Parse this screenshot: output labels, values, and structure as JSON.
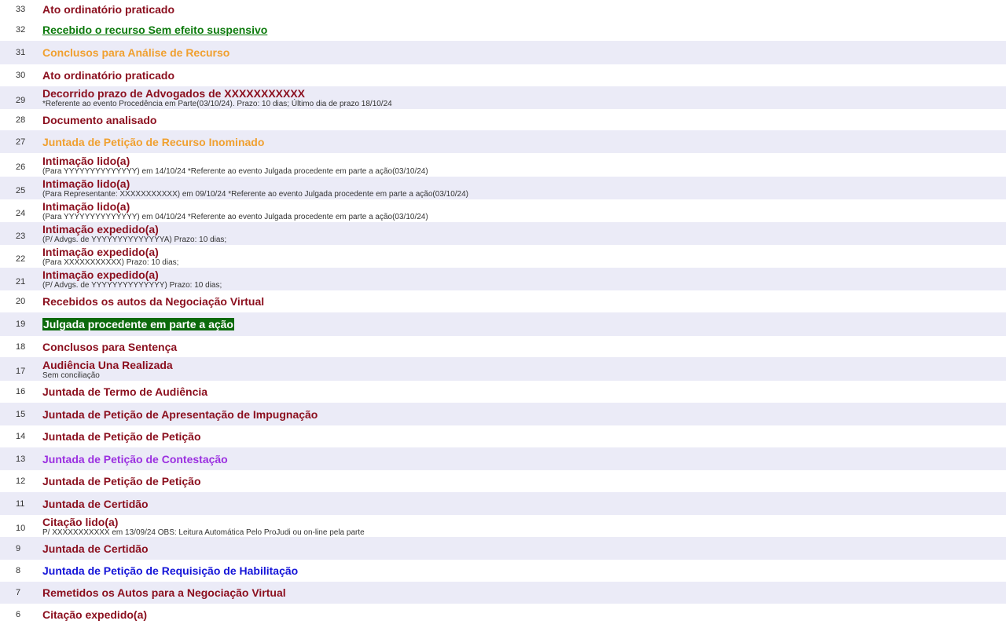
{
  "events": [
    {
      "num": "33",
      "title": "Ato ordinatório praticado",
      "detail": "",
      "style": "maroon"
    },
    {
      "num": "32",
      "title": "Recebido o recurso Sem efeito suspensivo",
      "detail": "",
      "style": "green-link"
    },
    {
      "num": "31",
      "title": "Conclusos para Análise de Recurso",
      "detail": "",
      "style": "orange"
    },
    {
      "num": "30",
      "title": "Ato ordinatório praticado",
      "detail": "",
      "style": "maroon"
    },
    {
      "num": "29",
      "title": "Decorrido prazo de Advogados de XXXXXXXXXXX",
      "detail": "*Referente ao evento Procedência em Parte(03/10/24). Prazo: 10 dias; Último dia de prazo 18/10/24",
      "style": "maroon"
    },
    {
      "num": "28",
      "title": "Documento analisado",
      "detail": "",
      "style": "maroon"
    },
    {
      "num": "27",
      "title": "Juntada de Petição de Recurso Inominado",
      "detail": "",
      "style": "orange"
    },
    {
      "num": "26",
      "title": "Intimação lido(a)",
      "detail": "(Para YYYYYYYYYYYYYY) em 14/10/24 *Referente ao evento Julgada procedente em parte a ação(03/10/24)",
      "style": "maroon"
    },
    {
      "num": "25",
      "title": "Intimação lido(a)",
      "detail": "(Para Representante: XXXXXXXXXXX) em 09/10/24 *Referente ao evento Julgada procedente em parte a ação(03/10/24)",
      "style": "maroon"
    },
    {
      "num": "24",
      "title": "Intimação lido(a)",
      "detail": "(Para YYYYYYYYYYYYYY) em 04/10/24 *Referente ao evento Julgada procedente em parte a ação(03/10/24)",
      "style": "maroon"
    },
    {
      "num": "23",
      "title": "Intimação expedido(a)",
      "detail": "(P/ Advgs. de YYYYYYYYYYYYYYA) Prazo: 10 dias;",
      "style": "maroon"
    },
    {
      "num": "22",
      "title": "Intimação expedido(a)",
      "detail": "(Para XXXXXXXXXXX) Prazo: 10 dias;",
      "style": "maroon"
    },
    {
      "num": "21",
      "title": "Intimação expedido(a)",
      "detail": "(P/ Advgs. de YYYYYYYYYYYYYY) Prazo: 10 dias;",
      "style": "maroon"
    },
    {
      "num": "20",
      "title": "Recebidos os autos da Negociação Virtual",
      "detail": "",
      "style": "maroon"
    },
    {
      "num": "19",
      "title": "Julgada procedente em parte a ação",
      "detail": "",
      "style": "green-hl"
    },
    {
      "num": "18",
      "title": "Conclusos para Sentença",
      "detail": "",
      "style": "maroon"
    },
    {
      "num": "17",
      "title": "Audiência Una Realizada",
      "detail": "Sem conciliação",
      "style": "maroon"
    },
    {
      "num": "16",
      "title": "Juntada de Termo de Audiência",
      "detail": "",
      "style": "maroon"
    },
    {
      "num": "15",
      "title": "Juntada de Petição de Apresentação de Impugnação",
      "detail": "",
      "style": "maroon"
    },
    {
      "num": "14",
      "title": "Juntada de Petição de Petição",
      "detail": "",
      "style": "maroon"
    },
    {
      "num": "13",
      "title": "Juntada de Petição de Contestação",
      "detail": "",
      "style": "purple"
    },
    {
      "num": "12",
      "title": "Juntada de Petição de Petição",
      "detail": "",
      "style": "maroon"
    },
    {
      "num": "11",
      "title": "Juntada de Certidão",
      "detail": "",
      "style": "maroon"
    },
    {
      "num": "10",
      "title": "Citação lido(a)",
      "detail": "P/ XXXXXXXXXXX em 13/09/24 OBS: Leitura Automática Pelo ProJudi ou on-line pela parte",
      "style": "maroon"
    },
    {
      "num": "9",
      "title": "Juntada de Certidão",
      "detail": "",
      "style": "maroon"
    },
    {
      "num": "8",
      "title": "Juntada de Petição de Requisição de Habilitação",
      "detail": "",
      "style": "blue"
    },
    {
      "num": "7",
      "title": "Remetidos os Autos para a Negociação Virtual",
      "detail": "",
      "style": "maroon"
    },
    {
      "num": "6",
      "title": "Citação expedido(a)",
      "detail": "",
      "style": "maroon"
    }
  ]
}
